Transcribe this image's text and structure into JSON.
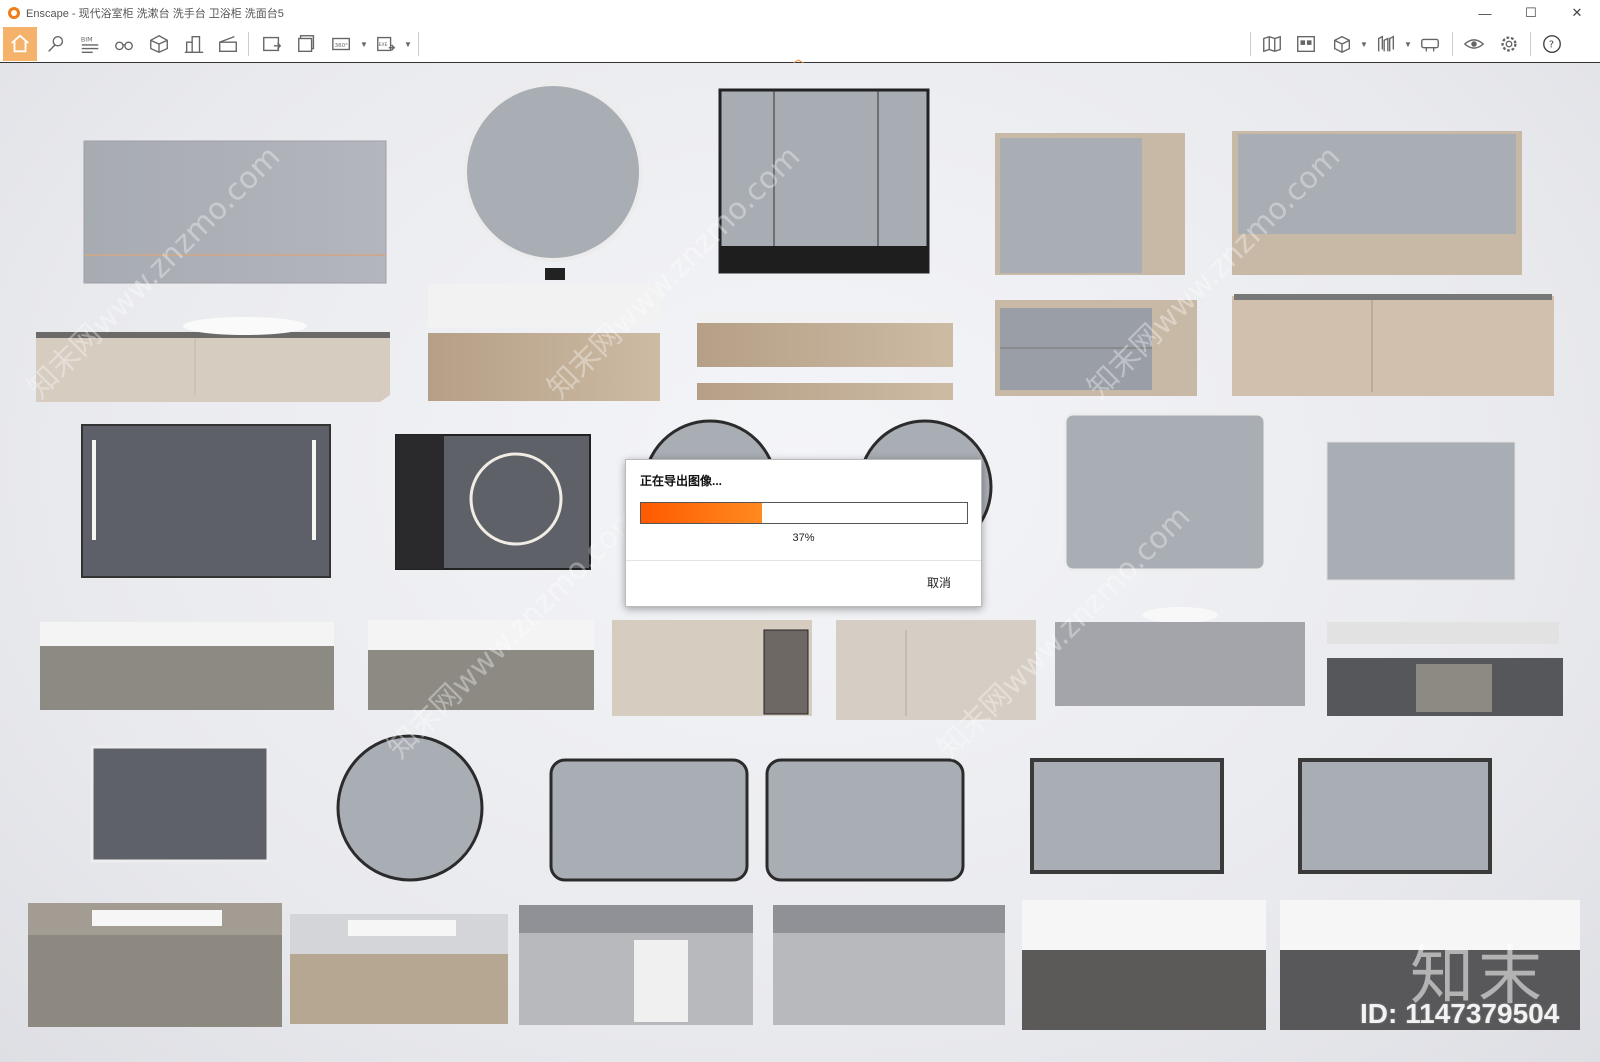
{
  "window": {
    "title": "Enscape - 现代浴室柜 洗漱台 洗手台 卫浴柜 洗面台5",
    "minimize_glyph": "—",
    "maximize_glyph": "☐",
    "close_glyph": "✕"
  },
  "toolbar": {
    "left_tools": [
      "home-icon",
      "location-pin-icon",
      "bim-icon",
      "binoculars-icon",
      "cube-icon",
      "buildings-icon",
      "clapperboard-icon",
      "render-image-icon",
      "batch-render-icon",
      "panorama-icon",
      "export-icon"
    ],
    "right_tools": [
      "map-icon",
      "asset-library-icon",
      "box-icon",
      "views-icon",
      "vr-headset-icon",
      "visibility-icon",
      "settings-icon",
      "help-icon"
    ],
    "bim_label": "BIM",
    "panorama_label": "360°",
    "export_label": "EXE",
    "help_label": "?",
    "collapse_glyph": "︿"
  },
  "dialog": {
    "title": "正在导出图像...",
    "progress": 0.37,
    "percent_text": "37%",
    "cancel_label": "取消"
  },
  "watermark": {
    "brand": "知末",
    "id_text": "ID: 1147379504",
    "diagonal_text": "知末网www.znzmo.com"
  },
  "colors": {
    "accent": "#f07d1a",
    "progress": "#ff6a00",
    "home_active": "#f5b26b",
    "mirror": "#a9adb4",
    "dark_mirror": "#5e6168",
    "wood": "#c8b9a6",
    "grey_cabinet": "#8a8780",
    "white_top": "#f3f3f3"
  }
}
